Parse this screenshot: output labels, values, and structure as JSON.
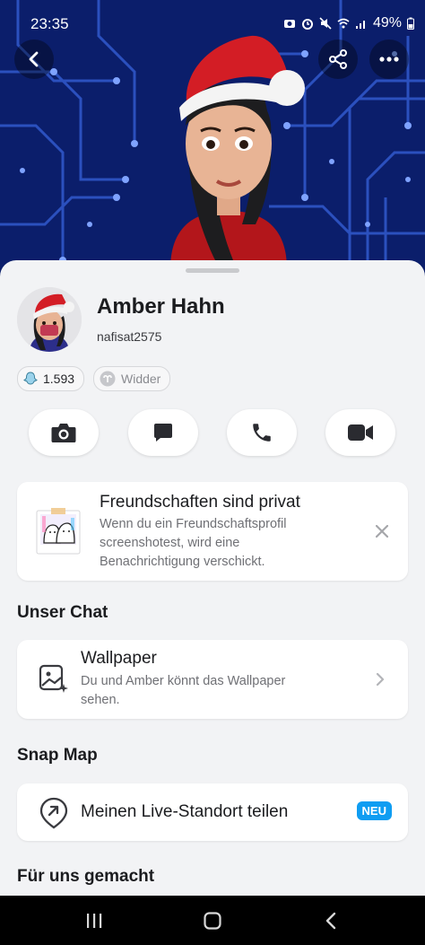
{
  "status_bar": {
    "time": "23:35",
    "battery": "49%",
    "icons": [
      "camera-status-icon",
      "alarm-icon",
      "mute-icon",
      "wifi-icon",
      "signal-icon",
      "battery-icon"
    ]
  },
  "header": {
    "back_icon": "chevron-left-icon",
    "share_icon": "share-icon",
    "more_icon": "more-dots-icon",
    "background_colors": {
      "base": "#0b1e6b",
      "trace": "#2f56c8"
    }
  },
  "profile": {
    "name": "Amber Hahn",
    "username": "nafisat2575",
    "snapscore": "1.593",
    "zodiac": "Widder"
  },
  "actions": [
    {
      "name": "camera",
      "icon": "camera-icon"
    },
    {
      "name": "chat",
      "icon": "chat-bubble-icon"
    },
    {
      "name": "call",
      "icon": "phone-icon"
    },
    {
      "name": "video",
      "icon": "video-camera-icon"
    }
  ],
  "privacy_card": {
    "title": "Freundschaften sind privat",
    "description": "Wenn du ein Freundschaftsprofil screenshotest, wird eine Benachrichtigung verschickt.",
    "description_lines": [
      "Wenn du ein Freundschaftsprofil",
      "screenshotest, wird eine",
      "Benachrichtigung verschickt."
    ],
    "close_icon": "close-icon"
  },
  "sections": {
    "chat_title": "Unser Chat",
    "map_title": "Snap Map",
    "made_for_us_title": "Für uns gemacht"
  },
  "wallpaper_card": {
    "title": "Wallpaper",
    "description_lines": [
      "Du und Amber könnt das Wallpaper",
      "sehen."
    ]
  },
  "location_card": {
    "title": "Meinen Live-Standort teilen",
    "badge": "NEU"
  },
  "nav_bar": {
    "recents_icon": "recents-icon",
    "home_icon": "home-icon",
    "back_icon": "back-icon"
  },
  "colors": {
    "accent_badge": "#0f9df2",
    "sheet_bg": "#f2f3f5",
    "text_primary": "#1b1c1f",
    "text_secondary": "#6f7075"
  }
}
